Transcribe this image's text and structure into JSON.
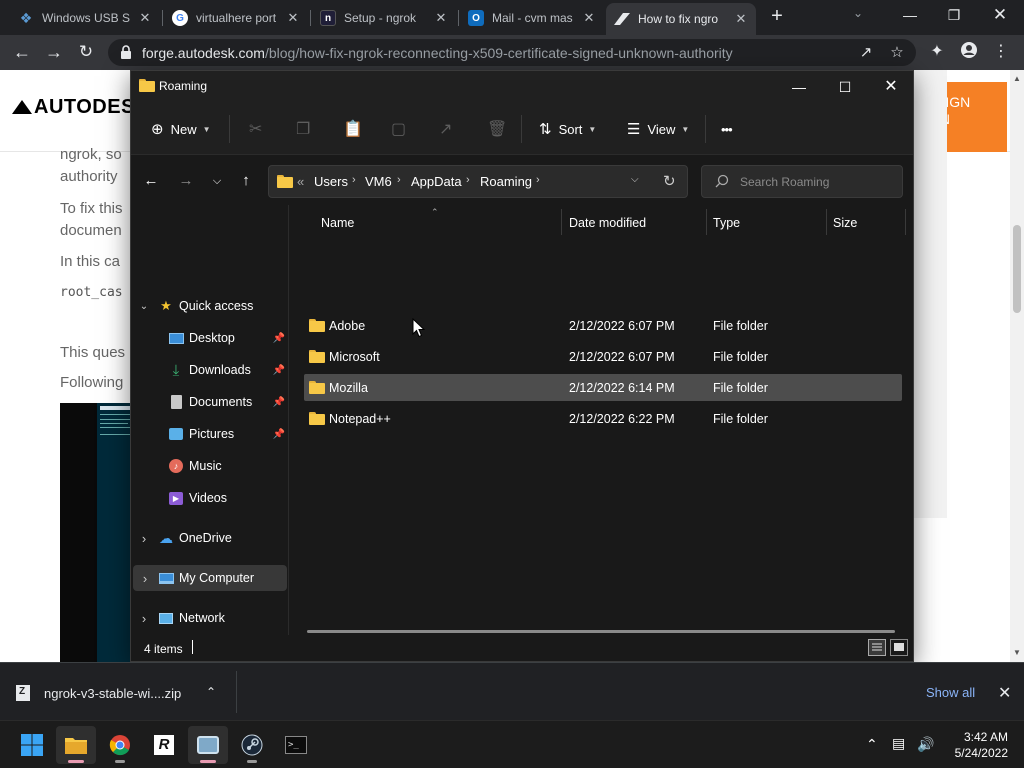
{
  "browser": {
    "tabs": [
      {
        "title": "Windows USB S",
        "favicon": "windows-usb-icon",
        "active": false
      },
      {
        "title": "virtualhere port",
        "favicon": "google-icon",
        "active": false
      },
      {
        "title": "Setup - ngrok",
        "favicon": "ngrok-icon",
        "active": false
      },
      {
        "title": "Mail - cvm mas",
        "favicon": "outlook-icon",
        "active": false
      },
      {
        "title": "How to fix ngro",
        "favicon": "autodesk-icon",
        "active": true
      }
    ],
    "url_domain": "forge.autodesk.com",
    "url_path": "/blog/how-fix-ngrok-reconnecting-x509-certificate-signed-unknown-authority"
  },
  "webpage": {
    "logo": "AUTODES",
    "signin": [
      "SIGN",
      "IN"
    ],
    "lines": [
      "ngrok, so",
      "authority",
      "To fix this",
      "documen",
      "In this ca",
      "root_cas",
      "This ques",
      "Following"
    ]
  },
  "explorer": {
    "title": "Roaming",
    "commands": {
      "new": "New",
      "sort": "Sort",
      "view": "View",
      "more": "•••"
    },
    "breadcrumb": [
      "«",
      "Users",
      "VM6",
      "AppData",
      "Roaming"
    ],
    "search_placeholder": "Search Roaming",
    "nav": [
      {
        "label": "Quick access",
        "icon": "star-icon",
        "level": 0,
        "expander": "⌄"
      },
      {
        "label": "Desktop",
        "icon": "desktop-icon",
        "level": 1,
        "pinned": true
      },
      {
        "label": "Downloads",
        "icon": "downloads-icon",
        "level": 1,
        "pinned": true
      },
      {
        "label": "Documents",
        "icon": "documents-icon",
        "level": 1,
        "pinned": true
      },
      {
        "label": "Pictures",
        "icon": "pictures-icon",
        "level": 1,
        "pinned": true
      },
      {
        "label": "Music",
        "icon": "music-icon",
        "level": 1,
        "pinned": false
      },
      {
        "label": "Videos",
        "icon": "videos-icon",
        "level": 1,
        "pinned": false
      },
      {
        "label": "OneDrive",
        "icon": "onedrive-icon",
        "level": 0,
        "expander": "›"
      },
      {
        "label": "My Computer",
        "icon": "computer-icon",
        "level": 0,
        "expander": "›",
        "selected": true
      },
      {
        "label": "Network",
        "icon": "network-icon",
        "level": 0,
        "expander": "›"
      }
    ],
    "columns": [
      "Name",
      "Date modified",
      "Type",
      "Size"
    ],
    "rows": [
      {
        "name": "Adobe",
        "date": "2/12/2022 6:07 PM",
        "type": "File folder",
        "size": ""
      },
      {
        "name": "Microsoft",
        "date": "2/12/2022 6:07 PM",
        "type": "File folder",
        "size": ""
      },
      {
        "name": "Mozilla",
        "date": "2/12/2022 6:14 PM",
        "type": "File folder",
        "size": "",
        "hover": true
      },
      {
        "name": "Notepad++",
        "date": "2/12/2022 6:22 PM",
        "type": "File folder",
        "size": ""
      }
    ],
    "status": "4 items"
  },
  "downloads": {
    "file": "ngrok-v3-stable-wi....zip",
    "show_all": "Show all"
  },
  "taskbar": {
    "time": "3:42 AM",
    "date": "5/24/2022"
  },
  "colors": {
    "autodesk_orange": "#f58025",
    "folder_yellow": "#f7c847",
    "explorer_bg": "#191919",
    "chrome_bg": "#202124",
    "link_blue": "#8ab4f8"
  }
}
